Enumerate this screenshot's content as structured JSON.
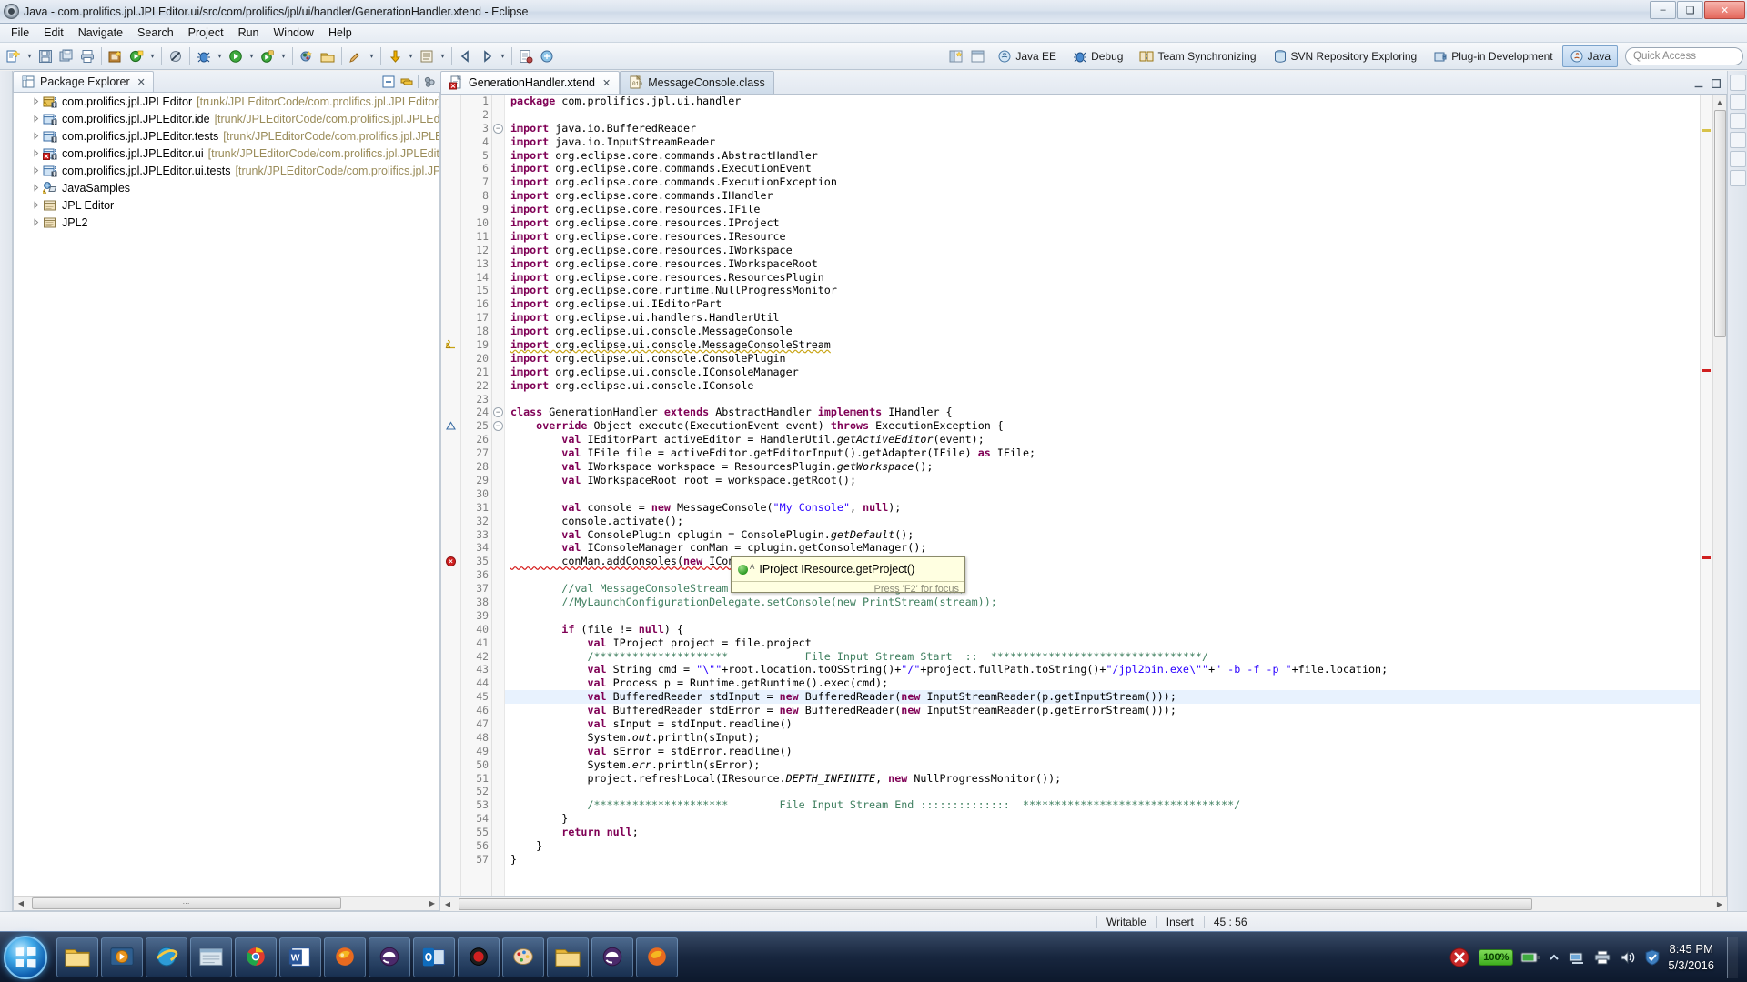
{
  "window": {
    "title": "Java - com.prolifics.jpl.JPLEditor.ui/src/com/prolifics/jpl/ui/handler/GenerationHandler.xtend - Eclipse",
    "app_icon": "eclipse-icon",
    "minimize_label": "–",
    "maximize_label": "❑",
    "close_label": "✕"
  },
  "menubar": {
    "items": [
      {
        "label": "File"
      },
      {
        "label": "Edit"
      },
      {
        "label": "Navigate"
      },
      {
        "label": "Search"
      },
      {
        "label": "Project"
      },
      {
        "label": "Run"
      },
      {
        "label": "Window"
      },
      {
        "label": "Help"
      }
    ]
  },
  "toolbar": {
    "perspectives": [
      {
        "label": "Java EE",
        "icon": "java-ee-perspective-icon",
        "active": false
      },
      {
        "label": "Debug",
        "icon": "debug-perspective-icon",
        "active": false
      },
      {
        "label": "Team Synchronizing",
        "icon": "team-sync-perspective-icon",
        "active": false
      },
      {
        "label": "SVN Repository Exploring",
        "icon": "svn-perspective-icon",
        "active": false
      },
      {
        "label": "Plug-in Development",
        "icon": "plugin-dev-perspective-icon",
        "active": false
      },
      {
        "label": "Java",
        "icon": "java-perspective-icon",
        "active": true
      }
    ],
    "quick_access_placeholder": "Quick Access"
  },
  "explorer": {
    "tab_label": "Package Explorer",
    "tab_icon": "package-explorer-icon",
    "tools": [
      {
        "icon": "collapse-all-icon"
      },
      {
        "icon": "link-with-editor-icon"
      },
      {
        "icon": "view-menu-icon"
      }
    ],
    "tree": [
      {
        "label": "com.prolifics.jpl.JPLEditor",
        "path": "[trunk/JPLEditorCode/com.prolifics.jpl.JPLEditor]",
        "icon": "java-project-warning-icon"
      },
      {
        "label": "com.prolifics.jpl.JPLEditor.ide",
        "path": "[trunk/JPLEditorCode/com.prolifics.jpl.JPLEdito",
        "icon": "java-project-icon"
      },
      {
        "label": "com.prolifics.jpl.JPLEditor.tests",
        "path": "[trunk/JPLEditorCode/com.prolifics.jpl.JPLEdit",
        "icon": "java-project-icon"
      },
      {
        "label": "com.prolifics.jpl.JPLEditor.ui",
        "path": "[trunk/JPLEditorCode/com.prolifics.jpl.JPLEditor",
        "icon": "java-project-error-icon"
      },
      {
        "label": "com.prolifics.jpl.JPLEditor.ui.tests",
        "path": "[trunk/JPLEditorCode/com.prolifics.jpl.JPLE",
        "icon": "java-project-icon"
      },
      {
        "label": "JavaSamples",
        "path": "",
        "icon": "java-project-warning-icon"
      },
      {
        "label": "JPL Editor",
        "path": "",
        "icon": "project-icon"
      },
      {
        "label": "JPL2",
        "path": "",
        "icon": "project-icon"
      }
    ],
    "hscroll_grip": "⋯"
  },
  "editor": {
    "tabs": [
      {
        "label": "GenerationHandler.xtend",
        "icon": "xtend-file-error-icon",
        "active": true,
        "close": "✕"
      },
      {
        "label": "MessageConsole.class",
        "icon": "class-file-icon",
        "active": false,
        "close": ""
      }
    ],
    "lines": [
      {
        "n": 1,
        "text": "package com.prolifics.jpl.ui.handler",
        "type": "package"
      },
      {
        "n": 2,
        "text": "",
        "type": "blank"
      },
      {
        "n": 3,
        "text": "import java.io.BufferedReader",
        "type": "import",
        "fold": true
      },
      {
        "n": 4,
        "text": "import java.io.InputStreamReader",
        "type": "import"
      },
      {
        "n": 5,
        "text": "import org.eclipse.core.commands.AbstractHandler",
        "type": "import"
      },
      {
        "n": 6,
        "text": "import org.eclipse.core.commands.ExecutionEvent",
        "type": "import"
      },
      {
        "n": 7,
        "text": "import org.eclipse.core.commands.ExecutionException",
        "type": "import"
      },
      {
        "n": 8,
        "text": "import org.eclipse.core.commands.IHandler",
        "type": "import"
      },
      {
        "n": 9,
        "text": "import org.eclipse.core.resources.IFile",
        "type": "import"
      },
      {
        "n": 10,
        "text": "import org.eclipse.core.resources.IProject",
        "type": "import"
      },
      {
        "n": 11,
        "text": "import org.eclipse.core.resources.IResource",
        "type": "import"
      },
      {
        "n": 12,
        "text": "import org.eclipse.core.resources.IWorkspace",
        "type": "import"
      },
      {
        "n": 13,
        "text": "import org.eclipse.core.resources.IWorkspaceRoot",
        "type": "import"
      },
      {
        "n": 14,
        "text": "import org.eclipse.core.resources.ResourcesPlugin",
        "type": "import"
      },
      {
        "n": 15,
        "text": "import org.eclipse.core.runtime.NullProgressMonitor",
        "type": "import"
      },
      {
        "n": 16,
        "text": "import org.eclipse.ui.IEditorPart",
        "type": "import"
      },
      {
        "n": 17,
        "text": "import org.eclipse.ui.handlers.HandlerUtil",
        "type": "import"
      },
      {
        "n": 18,
        "text": "import org.eclipse.ui.console.MessageConsole",
        "type": "import"
      },
      {
        "n": 19,
        "text": "import org.eclipse.ui.console.MessageConsoleStream",
        "type": "import",
        "marker": "warning",
        "squiggle": "warning"
      },
      {
        "n": 20,
        "text": "import org.eclipse.ui.console.ConsolePlugin",
        "type": "import"
      },
      {
        "n": 21,
        "text": "import org.eclipse.ui.console.IConsoleManager",
        "type": "import"
      },
      {
        "n": 22,
        "text": "import org.eclipse.ui.console.IConsole",
        "type": "import"
      },
      {
        "n": 23,
        "text": "",
        "type": "blank"
      },
      {
        "n": 24,
        "text": "class GenerationHandler extends AbstractHandler implements IHandler {",
        "type": "code",
        "fold": true
      },
      {
        "n": 25,
        "text": "    override Object execute(ExecutionEvent event) throws ExecutionException {",
        "type": "code",
        "fold": true,
        "marker": "override"
      },
      {
        "n": 26,
        "text": "        val IEditorPart activeEditor = HandlerUtil.getActiveEditor(event);",
        "type": "code"
      },
      {
        "n": 27,
        "text": "        val IFile file = activeEditor.getEditorInput().getAdapter(IFile) as IFile;",
        "type": "code"
      },
      {
        "n": 28,
        "text": "        val IWorkspace workspace = ResourcesPlugin.getWorkspace();",
        "type": "code"
      },
      {
        "n": 29,
        "text": "        val IWorkspaceRoot root = workspace.getRoot();",
        "type": "code"
      },
      {
        "n": 30,
        "text": "",
        "type": "blank"
      },
      {
        "n": 31,
        "text": "        val console = new MessageConsole(\"My Console\", null);",
        "type": "code"
      },
      {
        "n": 32,
        "text": "        console.activate();",
        "type": "code"
      },
      {
        "n": 33,
        "text": "        val ConsolePlugin cplugin = ConsolePlugin.getDefault();",
        "type": "code"
      },
      {
        "n": 34,
        "text": "        val IConsoleManager conMan = cplugin.getConsoleManager();",
        "type": "code"
      },
      {
        "n": 35,
        "text": "        conMan.addConsoles(new IConsole[]{ myConsole });",
        "type": "code",
        "marker": "error",
        "squiggle": "error"
      },
      {
        "n": 36,
        "text": "",
        "type": "blank"
      },
      {
        "n": 37,
        "text": "        //val MessageConsoleStream stream = console.newMessageStream();",
        "type": "comment"
      },
      {
        "n": 38,
        "text": "        //MyLaunchConfigurationDelegate.setConsole(new PrintStream(stream));",
        "type": "comment"
      },
      {
        "n": 39,
        "text": "",
        "type": "blank"
      },
      {
        "n": 40,
        "text": "        if (file != null) {",
        "type": "code"
      },
      {
        "n": 41,
        "text": "            val IProject project = file.project",
        "type": "code"
      },
      {
        "n": 42,
        "text": "            /*********************            File Input Stream Start  ::  *********************************/",
        "type": "comment"
      },
      {
        "n": 43,
        "text": "            val String cmd = \"\\\"\"+root.location.toOSString()+\"/\"+project.fullPath.toString()+\"/jpl2bin.exe\\\"\"+\" -b -f -p \"+file.location;",
        "type": "code"
      },
      {
        "n": 44,
        "text": "            val Process p = Runtime.getRuntime().exec(cmd);",
        "type": "code"
      },
      {
        "n": 45,
        "text": "            val BufferedReader stdInput = new BufferedReader(new InputStreamReader(p.getInputStream()));",
        "type": "code",
        "highlight": true
      },
      {
        "n": 46,
        "text": "            val BufferedReader stdError = new BufferedReader(new InputStreamReader(p.getErrorStream()));",
        "type": "code"
      },
      {
        "n": 47,
        "text": "            val sInput = stdInput.readline()",
        "type": "code"
      },
      {
        "n": 48,
        "text": "            System.out.println(sInput);",
        "type": "code"
      },
      {
        "n": 49,
        "text": "            val sError = stdError.readline()",
        "type": "code"
      },
      {
        "n": 50,
        "text": "            System.err.println(sError);",
        "type": "code"
      },
      {
        "n": 51,
        "text": "            project.refreshLocal(IResource.DEPTH_INFINITE, new NullProgressMonitor());",
        "type": "code"
      },
      {
        "n": 52,
        "text": "",
        "type": "blank"
      },
      {
        "n": 53,
        "text": "            /*********************        File Input Stream End ::::::::::::::  *********************************/",
        "type": "comment"
      },
      {
        "n": 54,
        "text": "        }",
        "type": "code"
      },
      {
        "n": 55,
        "text": "        return null;",
        "type": "code"
      },
      {
        "n": 56,
        "text": "    }",
        "type": "code"
      },
      {
        "n": 57,
        "text": "}",
        "type": "code"
      }
    ],
    "hover_tooltip": {
      "icon": "public-method-icon",
      "superscript": "A",
      "signature": "IProject IResource.getProject()",
      "footer": "Press 'F2' for focus"
    }
  },
  "statusbar": {
    "writable": "Writable",
    "insert_mode": "Insert",
    "cursor_position": "45 : 56"
  },
  "taskbar": {
    "start_label": "start-orb",
    "items": [
      {
        "icon": "folder-explorer-icon"
      },
      {
        "icon": "media-player-icon"
      },
      {
        "icon": "internet-explorer-icon"
      },
      {
        "icon": "file-manager-icon"
      },
      {
        "icon": "chrome-icon"
      },
      {
        "icon": "word-icon"
      },
      {
        "icon": "firefox-icon"
      },
      {
        "icon": "eclipse-icon"
      },
      {
        "icon": "outlook-icon"
      },
      {
        "icon": "app-red-icon"
      },
      {
        "icon": "paint-icon"
      },
      {
        "icon": "folder-yellow-icon"
      },
      {
        "icon": "eclipse-alt-icon"
      },
      {
        "icon": "eclipse-alt2-icon"
      }
    ],
    "tray": {
      "alert_icon": "alert-icon",
      "zoom_level": "100%",
      "battery_icon": "battery-icon",
      "chevron_icon": "show-hidden-icons-icon",
      "network_icon": "network-icon",
      "printer_icon": "printer-icon",
      "volume_icon": "volume-icon",
      "shield_icon": "security-icon",
      "time": "8:45 PM",
      "date": "5/3/2016"
    }
  }
}
